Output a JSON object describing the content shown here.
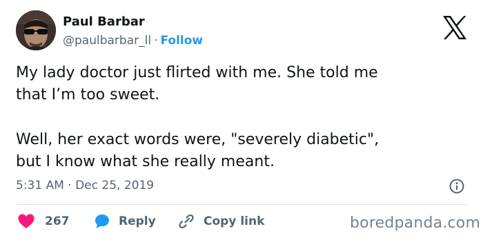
{
  "author": {
    "display_name": "Paul Barbar",
    "handle": "@paulbarbar_ll",
    "separator": "·",
    "follow_label": "Follow"
  },
  "tweet": {
    "paragraphs": [
      [
        "My lady doctor just flirted with me. She told me",
        "that I’m too sweet."
      ],
      [
        "Well, her exact words were, \"severely diabetic\",",
        "but I know what she really meant."
      ]
    ],
    "timestamp": "5:31 AM · Dec 25, 2019"
  },
  "actions": {
    "likes_count": "267",
    "reply_label": "Reply",
    "copy_link_label": "Copy link"
  },
  "watermark": "boredpanda.com",
  "icons": {
    "platform_logo": "x-logo-icon",
    "info": "info-icon",
    "like": "heart-icon",
    "reply": "speech-bubble-icon",
    "copy_link": "link-icon"
  },
  "colors": {
    "accent": "#1d9bf0",
    "like": "#f91880",
    "text_primary": "#0f1419",
    "text_secondary": "#536471",
    "watermark": "#77838b"
  }
}
